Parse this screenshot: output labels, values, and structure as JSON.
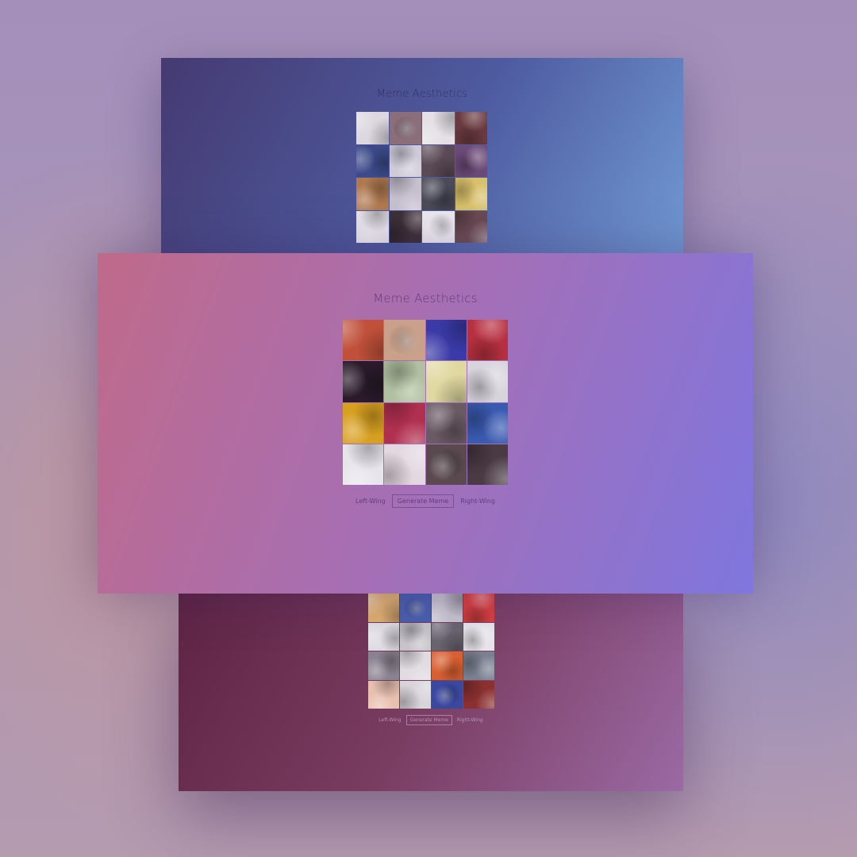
{
  "title": "Meme Aesthetics",
  "controls": {
    "left_label": "Left-Wing",
    "generate_label": "Generate Meme",
    "right_label": "Right-Wing"
  },
  "palettes": {
    "top": [
      "#ddd8e0",
      "#8a6e7a",
      "#e4e0e6",
      "#6a3a40",
      "#3c4a8a",
      "#cfcad8",
      "#5a4a55",
      "#6c4a78",
      "#b07a50",
      "#c7c0cf",
      "#4a4a58",
      "#d9c06a",
      "#e8e4ea",
      "#3e3038",
      "#ece8ef",
      "#6a4a52"
    ],
    "main": [
      "#c0503a",
      "#c9a08a",
      "#3a3aa8",
      "#b83040",
      "#2a1a2a",
      "#b0c0a0",
      "#e0d8a0",
      "#d8d4dc",
      "#d8a020",
      "#b03050",
      "#6a5a64",
      "#3a5ab0",
      "#e8e4ec",
      "#e4d8e0",
      "#5a4a50",
      "#4a3a44"
    ],
    "bottom": [
      "#e0b070",
      "#4a60b0",
      "#c8c4d0",
      "#d84040",
      "#e0dce4",
      "#c8c4ca",
      "#6a6470",
      "#e8e4ea",
      "#8a8290",
      "#e0dce2",
      "#d86030",
      "#7a8090",
      "#e8c0b0",
      "#d8d4da",
      "#3a48a0",
      "#8a3030"
    ]
  }
}
